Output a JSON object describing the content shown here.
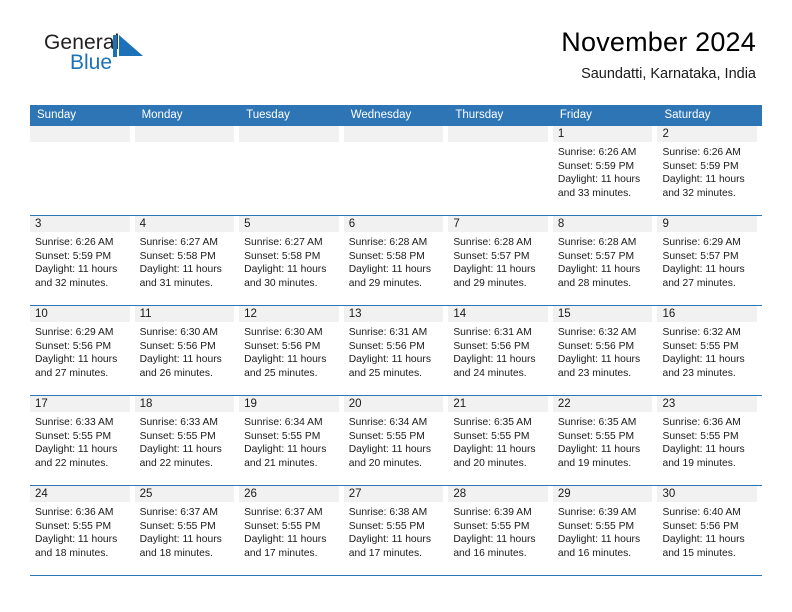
{
  "brand": {
    "name_part1": "General",
    "name_part2": "Blue",
    "mark": "triangle-logo-icon"
  },
  "header": {
    "title": "November 2024",
    "subtitle": "Saundatti, Karnataka, India"
  },
  "colors": {
    "header_blue": "#2e75b6",
    "brand_blue": "#1d71b8",
    "daynum_band": "#f1f1f1",
    "text": "#1a1a1a"
  },
  "weekdays": [
    "Sunday",
    "Monday",
    "Tuesday",
    "Wednesday",
    "Thursday",
    "Friday",
    "Saturday"
  ],
  "labels": {
    "sunrise_prefix": "Sunrise: ",
    "sunset_prefix": "Sunset: ",
    "daylight_prefix": "Daylight: "
  },
  "weeks": [
    [
      {
        "day": "",
        "empty": true
      },
      {
        "day": "",
        "empty": true
      },
      {
        "day": "",
        "empty": true
      },
      {
        "day": "",
        "empty": true
      },
      {
        "day": "",
        "empty": true
      },
      {
        "day": "1",
        "sunrise": "Sunrise: 6:26 AM",
        "sunset": "Sunset: 5:59 PM",
        "daylight_l1": "Daylight: 11 hours",
        "daylight_l2": "and 33 minutes."
      },
      {
        "day": "2",
        "sunrise": "Sunrise: 6:26 AM",
        "sunset": "Sunset: 5:59 PM",
        "daylight_l1": "Daylight: 11 hours",
        "daylight_l2": "and 32 minutes."
      }
    ],
    [
      {
        "day": "3",
        "sunrise": "Sunrise: 6:26 AM",
        "sunset": "Sunset: 5:59 PM",
        "daylight_l1": "Daylight: 11 hours",
        "daylight_l2": "and 32 minutes."
      },
      {
        "day": "4",
        "sunrise": "Sunrise: 6:27 AM",
        "sunset": "Sunset: 5:58 PM",
        "daylight_l1": "Daylight: 11 hours",
        "daylight_l2": "and 31 minutes."
      },
      {
        "day": "5",
        "sunrise": "Sunrise: 6:27 AM",
        "sunset": "Sunset: 5:58 PM",
        "daylight_l1": "Daylight: 11 hours",
        "daylight_l2": "and 30 minutes."
      },
      {
        "day": "6",
        "sunrise": "Sunrise: 6:28 AM",
        "sunset": "Sunset: 5:58 PM",
        "daylight_l1": "Daylight: 11 hours",
        "daylight_l2": "and 29 minutes."
      },
      {
        "day": "7",
        "sunrise": "Sunrise: 6:28 AM",
        "sunset": "Sunset: 5:57 PM",
        "daylight_l1": "Daylight: 11 hours",
        "daylight_l2": "and 29 minutes."
      },
      {
        "day": "8",
        "sunrise": "Sunrise: 6:28 AM",
        "sunset": "Sunset: 5:57 PM",
        "daylight_l1": "Daylight: 11 hours",
        "daylight_l2": "and 28 minutes."
      },
      {
        "day": "9",
        "sunrise": "Sunrise: 6:29 AM",
        "sunset": "Sunset: 5:57 PM",
        "daylight_l1": "Daylight: 11 hours",
        "daylight_l2": "and 27 minutes."
      }
    ],
    [
      {
        "day": "10",
        "sunrise": "Sunrise: 6:29 AM",
        "sunset": "Sunset: 5:56 PM",
        "daylight_l1": "Daylight: 11 hours",
        "daylight_l2": "and 27 minutes."
      },
      {
        "day": "11",
        "sunrise": "Sunrise: 6:30 AM",
        "sunset": "Sunset: 5:56 PM",
        "daylight_l1": "Daylight: 11 hours",
        "daylight_l2": "and 26 minutes."
      },
      {
        "day": "12",
        "sunrise": "Sunrise: 6:30 AM",
        "sunset": "Sunset: 5:56 PM",
        "daylight_l1": "Daylight: 11 hours",
        "daylight_l2": "and 25 minutes."
      },
      {
        "day": "13",
        "sunrise": "Sunrise: 6:31 AM",
        "sunset": "Sunset: 5:56 PM",
        "daylight_l1": "Daylight: 11 hours",
        "daylight_l2": "and 25 minutes."
      },
      {
        "day": "14",
        "sunrise": "Sunrise: 6:31 AM",
        "sunset": "Sunset: 5:56 PM",
        "daylight_l1": "Daylight: 11 hours",
        "daylight_l2": "and 24 minutes."
      },
      {
        "day": "15",
        "sunrise": "Sunrise: 6:32 AM",
        "sunset": "Sunset: 5:56 PM",
        "daylight_l1": "Daylight: 11 hours",
        "daylight_l2": "and 23 minutes."
      },
      {
        "day": "16",
        "sunrise": "Sunrise: 6:32 AM",
        "sunset": "Sunset: 5:55 PM",
        "daylight_l1": "Daylight: 11 hours",
        "daylight_l2": "and 23 minutes."
      }
    ],
    [
      {
        "day": "17",
        "sunrise": "Sunrise: 6:33 AM",
        "sunset": "Sunset: 5:55 PM",
        "daylight_l1": "Daylight: 11 hours",
        "daylight_l2": "and 22 minutes."
      },
      {
        "day": "18",
        "sunrise": "Sunrise: 6:33 AM",
        "sunset": "Sunset: 5:55 PM",
        "daylight_l1": "Daylight: 11 hours",
        "daylight_l2": "and 22 minutes."
      },
      {
        "day": "19",
        "sunrise": "Sunrise: 6:34 AM",
        "sunset": "Sunset: 5:55 PM",
        "daylight_l1": "Daylight: 11 hours",
        "daylight_l2": "and 21 minutes."
      },
      {
        "day": "20",
        "sunrise": "Sunrise: 6:34 AM",
        "sunset": "Sunset: 5:55 PM",
        "daylight_l1": "Daylight: 11 hours",
        "daylight_l2": "and 20 minutes."
      },
      {
        "day": "21",
        "sunrise": "Sunrise: 6:35 AM",
        "sunset": "Sunset: 5:55 PM",
        "daylight_l1": "Daylight: 11 hours",
        "daylight_l2": "and 20 minutes."
      },
      {
        "day": "22",
        "sunrise": "Sunrise: 6:35 AM",
        "sunset": "Sunset: 5:55 PM",
        "daylight_l1": "Daylight: 11 hours",
        "daylight_l2": "and 19 minutes."
      },
      {
        "day": "23",
        "sunrise": "Sunrise: 6:36 AM",
        "sunset": "Sunset: 5:55 PM",
        "daylight_l1": "Daylight: 11 hours",
        "daylight_l2": "and 19 minutes."
      }
    ],
    [
      {
        "day": "24",
        "sunrise": "Sunrise: 6:36 AM",
        "sunset": "Sunset: 5:55 PM",
        "daylight_l1": "Daylight: 11 hours",
        "daylight_l2": "and 18 minutes."
      },
      {
        "day": "25",
        "sunrise": "Sunrise: 6:37 AM",
        "sunset": "Sunset: 5:55 PM",
        "daylight_l1": "Daylight: 11 hours",
        "daylight_l2": "and 18 minutes."
      },
      {
        "day": "26",
        "sunrise": "Sunrise: 6:37 AM",
        "sunset": "Sunset: 5:55 PM",
        "daylight_l1": "Daylight: 11 hours",
        "daylight_l2": "and 17 minutes."
      },
      {
        "day": "27",
        "sunrise": "Sunrise: 6:38 AM",
        "sunset": "Sunset: 5:55 PM",
        "daylight_l1": "Daylight: 11 hours",
        "daylight_l2": "and 17 minutes."
      },
      {
        "day": "28",
        "sunrise": "Sunrise: 6:39 AM",
        "sunset": "Sunset: 5:55 PM",
        "daylight_l1": "Daylight: 11 hours",
        "daylight_l2": "and 16 minutes."
      },
      {
        "day": "29",
        "sunrise": "Sunrise: 6:39 AM",
        "sunset": "Sunset: 5:55 PM",
        "daylight_l1": "Daylight: 11 hours",
        "daylight_l2": "and 16 minutes."
      },
      {
        "day": "30",
        "sunrise": "Sunrise: 6:40 AM",
        "sunset": "Sunset: 5:56 PM",
        "daylight_l1": "Daylight: 11 hours",
        "daylight_l2": "and 15 minutes."
      }
    ]
  ]
}
